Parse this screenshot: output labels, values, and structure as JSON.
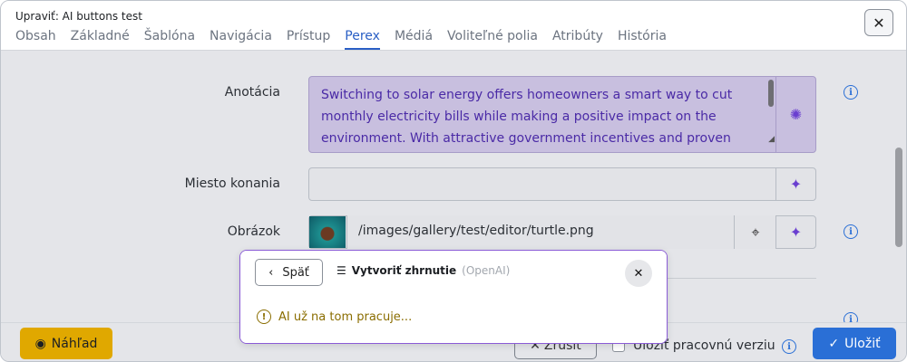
{
  "header": {
    "title": "Upraviť: AI buttons test",
    "tabs": [
      "Obsah",
      "Základné",
      "Šablóna",
      "Navigácia",
      "Prístup",
      "Perex",
      "Médiá",
      "Voliteľné polia",
      "Atribúty",
      "História"
    ],
    "active_tab": "Perex",
    "close_icon": "close-icon"
  },
  "form": {
    "anotacia_label": "Anotácia",
    "anotacia_value": "Switching to solar energy offers homeowners a smart way to cut monthly electricity bills while making a positive impact on the environment. With attractive government incentives and proven",
    "miesto_label": "Miesto konania",
    "miesto_value": "",
    "obrazok_label": "Obrázok",
    "obrazok_path": "/images/gallery/test/editor/turtle.png"
  },
  "footer": {
    "preview_label": "Náhľad",
    "cancel_label": "Zrušiť",
    "draft_label": "Uložiť pracovnú verziu",
    "save_label": "Uložiť"
  },
  "popup": {
    "back_label": "Späť",
    "title": "Vytvoriť zhrnutie",
    "provider": "(OpenAI)",
    "status": "AI už na tom pracuje..."
  },
  "colors": {
    "accent": "#2a6fd6",
    "ai_purple": "#6a3fd0",
    "preview": "#e0a800",
    "warning": "#8a6d00"
  }
}
